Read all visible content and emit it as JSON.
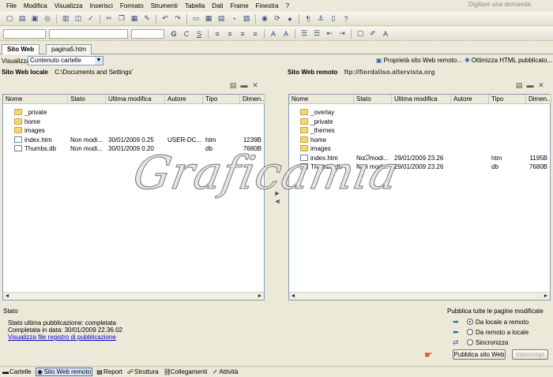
{
  "menu": [
    "File",
    "Modifica",
    "Visualizza",
    "Inserisci",
    "Formato",
    "Strumenti",
    "Tabella",
    "Dati",
    "Frame",
    "Finestra",
    "?"
  ],
  "help_placeholder": "Digitare una domanda.",
  "tabs": [
    {
      "label": "Sito Web",
      "active": true
    },
    {
      "label": "pagina5.htm",
      "active": false
    }
  ],
  "view": {
    "label": "Visualizza",
    "value": "Contenuto cartelle",
    "publish_props": "Proprietà sito Web remoto...",
    "optimize": "Ottimizza HTML pubblicato..."
  },
  "local": {
    "title": "Sito Web locale",
    "path": "C:\\Documents and Settings'",
    "columns": [
      "Nome",
      "Stato",
      "Ultima modifica",
      "Autore",
      "Tipo",
      "Dimen..."
    ],
    "rows": [
      {
        "name": "_private",
        "type": "folder",
        "state": "",
        "modified": "",
        "author": "",
        "ext": "",
        "size": ""
      },
      {
        "name": "home",
        "type": "folder",
        "state": "",
        "modified": "",
        "author": "",
        "ext": "",
        "size": ""
      },
      {
        "name": "images",
        "type": "folder",
        "state": "",
        "modified": "",
        "author": "",
        "ext": "",
        "size": ""
      },
      {
        "name": "index.htm",
        "type": "file",
        "state": "Non modi...",
        "modified": "30/01/2009 0.25",
        "author": "USER-DC...",
        "ext": "htm",
        "size": "1239B"
      },
      {
        "name": "Thumbs.db",
        "type": "file",
        "state": "Non modi...",
        "modified": "30/01/2009 0.20",
        "author": "",
        "ext": "db",
        "size": "7680B"
      }
    ]
  },
  "remote": {
    "title": "Sito Web remoto",
    "path": "ftp://fiordaliso.altervista.org",
    "columns": [
      "Nome",
      "Stato",
      "Ultima modifica",
      "Autore",
      "Tipo",
      "Dimen..."
    ],
    "rows": [
      {
        "name": "_overlay",
        "type": "folder",
        "state": "",
        "modified": "",
        "author": "",
        "ext": "",
        "size": ""
      },
      {
        "name": "_private",
        "type": "folder",
        "state": "",
        "modified": "",
        "author": "",
        "ext": "",
        "size": ""
      },
      {
        "name": "_themes",
        "type": "folder",
        "state": "",
        "modified": "",
        "author": "",
        "ext": "",
        "size": ""
      },
      {
        "name": "home",
        "type": "folder",
        "state": "",
        "modified": "",
        "author": "",
        "ext": "",
        "size": ""
      },
      {
        "name": "images",
        "type": "folder",
        "state": "",
        "modified": "",
        "author": "",
        "ext": "",
        "size": ""
      },
      {
        "name": "index.htm",
        "type": "file",
        "state": "Non modi...",
        "modified": "29/01/2009 23.26",
        "author": "",
        "ext": "htm",
        "size": "1195B"
      },
      {
        "name": "Thumbs.db",
        "type": "file",
        "state": "Non modi...",
        "modified": "29/01/2009 23.26",
        "author": "",
        "ext": "db",
        "size": "7680B"
      }
    ]
  },
  "watermark": "Graficamia",
  "status": {
    "label": "Stato",
    "line1": "Stato ultima pubblicazione: completata",
    "line2": "Completata in data: 30/01/2009 22.36.02",
    "link": "Visualizza file registro di pubblicazione"
  },
  "publish": {
    "title": "Pubblica tutte le pagine modificate",
    "options": [
      {
        "label": "Da locale a remoto",
        "selected": true
      },
      {
        "label": "Da remoto a locale",
        "selected": false
      },
      {
        "label": "Sincronizza",
        "selected": false
      }
    ],
    "button": "Pubblica sito Web",
    "stop": "Interrompi"
  },
  "statusbar": [
    {
      "label": "Cartelle",
      "icon": "folder-icon",
      "active": false
    },
    {
      "label": "Sito Web remoto",
      "icon": "globe-icon",
      "active": true
    },
    {
      "label": "Report",
      "icon": "report-icon",
      "active": false
    },
    {
      "label": "Struttura",
      "icon": "hierarchy-icon",
      "active": false
    },
    {
      "label": "Collegamenti",
      "icon": "link-icon",
      "active": false
    },
    {
      "label": "Attività",
      "icon": "task-icon",
      "active": false
    }
  ],
  "colors": {
    "accent": "#2a5fc2",
    "link": "#0000cc",
    "pane_border": "#7f9db9",
    "toolbar_bg": "#ece9d8"
  }
}
